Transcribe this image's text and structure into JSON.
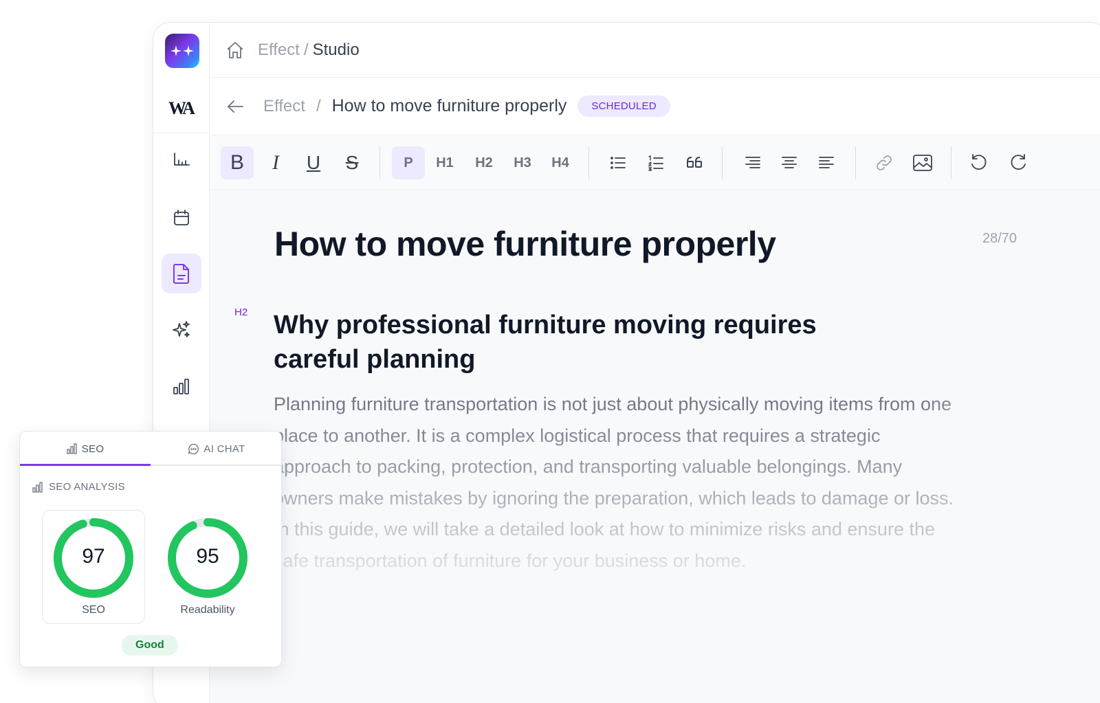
{
  "breadcrumb": {
    "parent": "Effect",
    "separator": "/",
    "current": "Studio"
  },
  "sub_breadcrumb": {
    "parent": "Effect",
    "separator": "/",
    "title": "How to move furniture properly",
    "status": "SCHEDULED"
  },
  "brand": {
    "monogram": "WA"
  },
  "toolbar": {
    "bold": "B",
    "italic": "I",
    "underline": "U",
    "strike": "S",
    "paragraph": "P",
    "h1": "H1",
    "h2": "H2",
    "h3": "H3",
    "h4": "H4"
  },
  "document": {
    "title": "How to move furniture properly",
    "title_counter": "28/70",
    "heading_tag": "H2",
    "heading": "Why professional furniture moving requires careful planning",
    "paragraph": "Planning furniture transportation is not just about physically moving items from one place to another. It is a complex logistical process that requires a strategic approach to packing, protection, and transporting valuable belongings. Many owners make mistakes by ignoring the preparation, which leads to damage or loss. In this guide, we will take a detailed look at how to minimize risks and ensure the safe transportation of furniture for your business or home."
  },
  "seo_panel": {
    "tabs": [
      {
        "label": "SEO"
      },
      {
        "label": "AI CHAT"
      }
    ],
    "section_title": "SEO ANALYSIS",
    "scores": [
      {
        "label": "SEO",
        "value": 97
      },
      {
        "label": "Readability",
        "value": 95
      }
    ],
    "verdict": "Good"
  },
  "colors": {
    "accent": "#7c3aed",
    "score_ring": "#22c55e",
    "ring_track": "#e5e7eb"
  }
}
